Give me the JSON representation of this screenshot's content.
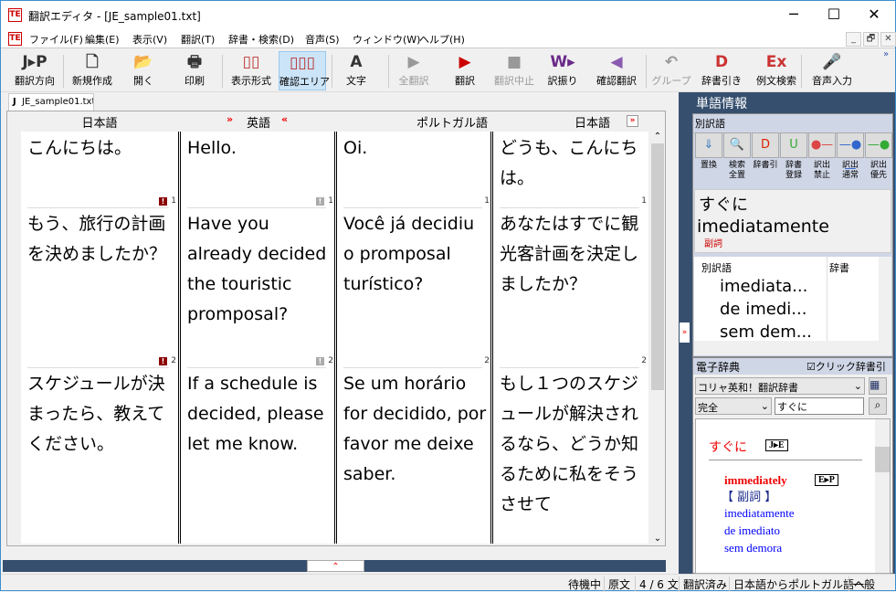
{
  "window": {
    "title": "翻訳エディタ - [JE_sample01.txt]",
    "logo": "TE",
    "minimize": "─",
    "maximize": "☐",
    "close": "✕"
  },
  "menu": [
    "ファイル(F)",
    "編集(E)",
    "表示(V)",
    "翻訳(T)",
    "辞書・検索(D)",
    "音声(S)",
    "ウィンドウ(W)",
    "ヘルプ(H)"
  ],
  "mdi": {
    "minimize": "_",
    "restore": "🗗",
    "close": "✕"
  },
  "toolbar": [
    {
      "label": "翻訳方向",
      "icon": "J▸P",
      "dropdown": true
    },
    {
      "label": "新規作成",
      "icon": "🗋"
    },
    {
      "label": "開く",
      "icon": "📂",
      "dropdown": true
    },
    {
      "label": "印刷",
      "icon": "🖶",
      "dropdown": true
    },
    {
      "label": "表示形式",
      "icon": "▯▯",
      "dropdown": true
    },
    {
      "label": "確認エリア",
      "icon": "▯▯▯",
      "selected": true
    },
    {
      "label": "文字",
      "icon": "A",
      "dropdown": true
    },
    {
      "label": "全翻訳",
      "icon": "▶",
      "disabled": true
    },
    {
      "label": "翻訳",
      "icon": "▶"
    },
    {
      "label": "翻訳中止",
      "icon": "■",
      "disabled": true
    },
    {
      "label": "訳振り",
      "icon": "W▸"
    },
    {
      "label": "確認翻訳",
      "icon": "◀"
    },
    {
      "label": "グループ",
      "icon": "↶",
      "disabled": true,
      "dropdown": true
    },
    {
      "label": "辞書引き",
      "icon": "D"
    },
    {
      "label": "例文検索",
      "icon": "Ex"
    },
    {
      "label": "音声入力",
      "icon": "🎤"
    }
  ],
  "toolbar_overflow": "»",
  "tab": {
    "label": "JE_sample01.txt",
    "prefix": "J"
  },
  "grid": {
    "headers": [
      "日本語",
      "英語",
      "ポルトガル語",
      "日本語"
    ],
    "arrows": {
      "left": "»",
      "right": "«",
      "end": "»"
    },
    "rows": [
      {
        "cells": [
          "こんにちは。",
          "Hello.",
          "Oi.",
          "どうも、こんにちは。"
        ],
        "num": "1",
        "flags": [
          "error",
          "warn"
        ]
      },
      {
        "cells": [
          "もう、旅行の計画を決めましたか？",
          "Have you already decided the touristic promposal?",
          "Você já decidiu o promposal turístico?",
          "あなたはすでに観光客計画を決定しましたか？"
        ],
        "num": "2",
        "flags": [
          "error",
          "warn"
        ]
      },
      {
        "cells": [
          "スケジュールが決まったら、教えてください。",
          "If a schedule is decided, please let me know.",
          "Se um horário for decidido, por favor me deixe saber.",
          "もし１つのスケジュールが解決されるなら、どうか知るために私をそうさせて"
        ]
      }
    ],
    "first_nums": "1"
  },
  "splitter": "⌃",
  "side_toggle": "»",
  "word_info": {
    "title": "単語情報",
    "alt_title": "別訳語",
    "buttons": [
      "置換",
      "検索\n全置",
      "辞書引",
      "辞書\n登録",
      "訳出\n禁止",
      "訳出\n通常",
      "訳出\n優先"
    ],
    "source": "すぐに",
    "target": "imediatamente",
    "pos": "副詞",
    "table_headers": [
      "別訳語",
      "辞書"
    ],
    "alternatives": [
      "imediata...",
      "de imedi...",
      "sem dem..."
    ]
  },
  "dictionary": {
    "title": "電子辞典",
    "click_lookup": "クリック辞書引",
    "click_lookup_checked": true,
    "dict_select": "コリャ英和！翻訳辞書",
    "mode_select": "完全",
    "query": "すぐに",
    "entry": "すぐに",
    "entry_tag": "J▸E",
    "sub_entry": "immediately",
    "sub_tag": "E▸P",
    "pos": "【 副詞 】",
    "meanings": [
      "imediatamente",
      "de imediato",
      "sem demora"
    ]
  },
  "status": [
    "待機中",
    "原文",
    "4 / 6 文",
    "翻訳済み",
    "日本語からポルトガル語へ",
    "一般"
  ]
}
